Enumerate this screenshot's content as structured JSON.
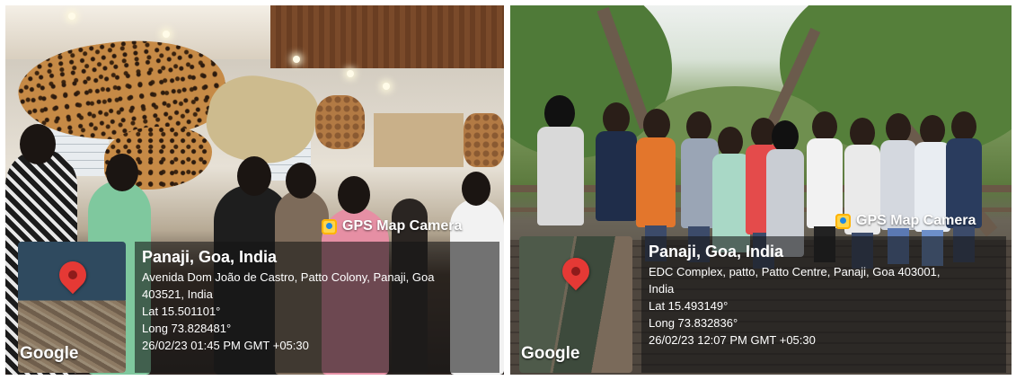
{
  "photos": [
    {
      "badge": "GPS Map Camera",
      "place": "Panaji, Goa, India",
      "address_line1": "Avenida Dom João de Castro, Patto Colony, Panaji, Goa",
      "address_line2": "403521, India",
      "lat": "Lat 15.501101°",
      "long": "Long 73.828481°",
      "datetime": "26/02/23 01:45 PM GMT +05:30",
      "map_label": "Google"
    },
    {
      "badge": "GPS Map Camera",
      "place": "Panaji, Goa, India",
      "address_line1": "EDC Complex, patto, Patto Centre, Panaji, Goa 403001,",
      "address_line2": "India",
      "lat": "Lat 15.493149°",
      "long": "Long 73.832836°",
      "datetime": "26/02/23 12:07 PM GMT +05:30",
      "map_label": "Google"
    }
  ],
  "icons": {
    "camera": "gps-camera-icon",
    "pin": "map-pin-icon"
  },
  "colors": {
    "pin": "#e53935",
    "overlay": "rgba(20,20,20,0.58)",
    "camera_icon": "#ffd54a"
  }
}
